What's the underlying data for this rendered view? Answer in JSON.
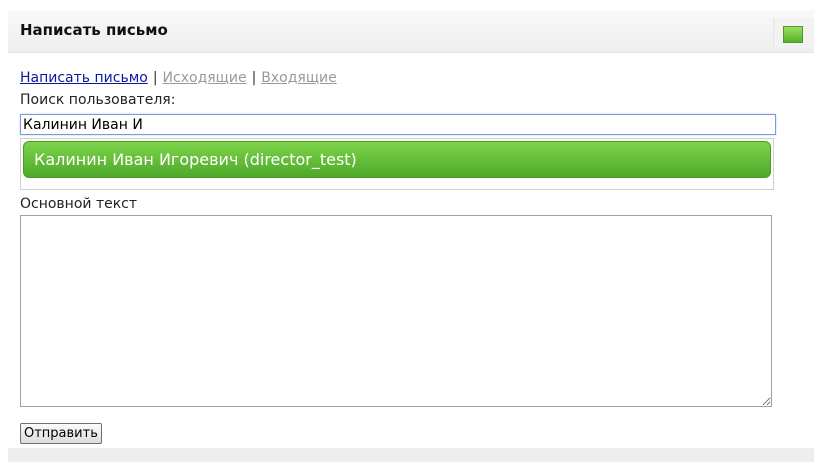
{
  "header": {
    "title": "Написать письмо",
    "action_color": "#66c233"
  },
  "nav": {
    "items": [
      {
        "label": "Написать письмо",
        "active": true
      },
      {
        "label": "Исходящие",
        "active": false
      },
      {
        "label": "Входящие",
        "active": false
      }
    ],
    "separator": "|"
  },
  "search": {
    "label": "Поиск пользователя:",
    "value": "Калинин Иван И"
  },
  "autocomplete": {
    "items": [
      {
        "label": "Калинин Иван Игоревич (director_test)",
        "highlighted": true
      }
    ],
    "highlight_color": "#66c233"
  },
  "message": {
    "label": "Основной текст",
    "value": ""
  },
  "actions": {
    "send_label": "Отправить"
  }
}
